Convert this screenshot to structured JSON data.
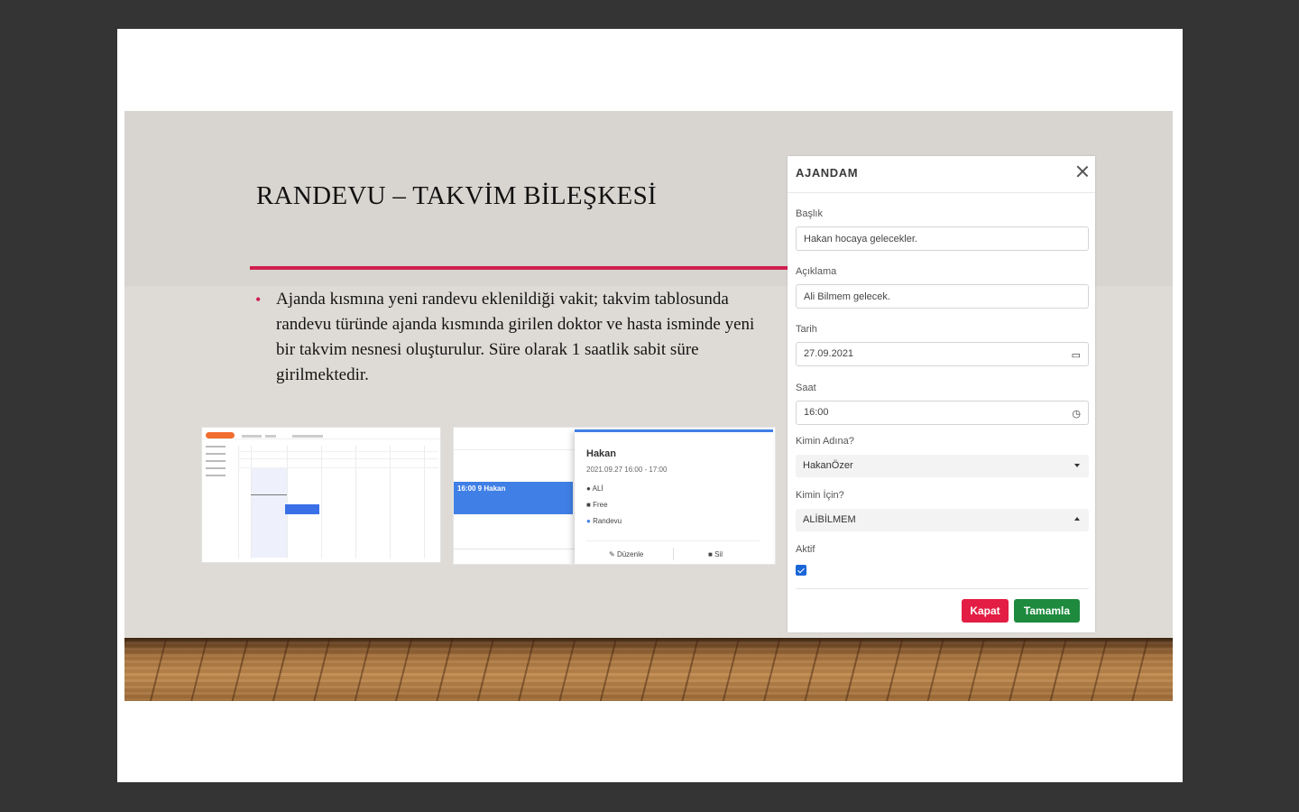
{
  "slide": {
    "title": "RANDEVU – TAKVİM BİLEŞKESİ",
    "bullet_marker": "•",
    "bullet_text": "Ajanda kısmına yeni randevu eklenildiği vakit; takvim tablosunda randevu türünde ajanda kısmında girilen doktor ve hasta isminde yeni bir takvim nesnesi oluşturulur. Süre olarak 1 saatlik sabit süre girilmektedir.",
    "accent_color": "#d11f4f"
  },
  "screenshot2": {
    "event_label": "16:00 9 Hakan",
    "popup": {
      "name": "Hakan",
      "time": "2021.09.27 16:00 - 17:00",
      "location": "ALİ",
      "status": "Free",
      "type": "Randevu",
      "edit_label": "Düzenle",
      "delete_label": "Sil"
    }
  },
  "modal": {
    "title": "AJANDAM",
    "fields": {
      "baslik_label": "Başlık",
      "baslik_value": "Hakan hocaya gelecekler.",
      "aciklama_label": "Açıklama",
      "aciklama_value": "Ali Bilmem gelecek.",
      "tarih_label": "Tarih",
      "tarih_value": "27.09.2021",
      "saat_label": "Saat",
      "saat_value": "16:00",
      "kimin_adina_label": "Kimin Adına?",
      "kimin_adina_value": "HakanÖzer",
      "kimin_icin_label": "Kimin İçin?",
      "kimin_icin_value": "ALİBİLMEM",
      "aktif_label": "Aktif",
      "aktif_checked": true
    },
    "buttons": {
      "kapat": "Kapat",
      "tamamla": "Tamamla"
    },
    "colors": {
      "kapat": "#e31d43",
      "tamamla": "#1d8a3e",
      "checkbox": "#1a66d8"
    }
  }
}
